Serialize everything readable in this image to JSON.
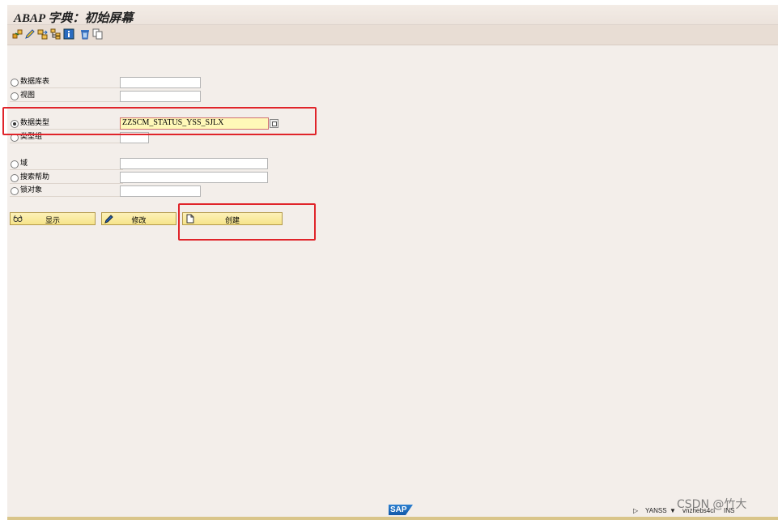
{
  "window": {
    "title": "ABAP 字典：初始屏幕"
  },
  "toolbar": {
    "icons": [
      "other-object-icon",
      "edit-pencil-icon",
      "where-used-icon",
      "hierarchy-icon",
      "info-icon",
      "delete-trash-icon",
      "copy-icon"
    ]
  },
  "form": {
    "options": [
      {
        "label": "数据库表",
        "selected": false,
        "value": ""
      },
      {
        "label": "视图",
        "selected": false,
        "value": ""
      },
      {
        "label": "数据类型",
        "selected": true,
        "value": "ZZSCM_STATUS_YSS_SJLX"
      },
      {
        "label": "类型组",
        "selected": false,
        "value": ""
      },
      {
        "label": "域",
        "selected": false,
        "value": ""
      },
      {
        "label": "搜索帮助",
        "selected": false,
        "value": ""
      },
      {
        "label": "锁对象",
        "selected": false,
        "value": ""
      }
    ]
  },
  "buttons": {
    "display": "显示",
    "change": "修改",
    "create": "创建"
  },
  "status": {
    "user": "YANSS",
    "system": "vnzhebs4ci",
    "mode": "INS",
    "logo": "SAP"
  },
  "watermark": "CSDN @竹大",
  "colors": {
    "highlight": "#e0242a",
    "button": "#f6e48a",
    "active_field": "#fff8b8"
  }
}
